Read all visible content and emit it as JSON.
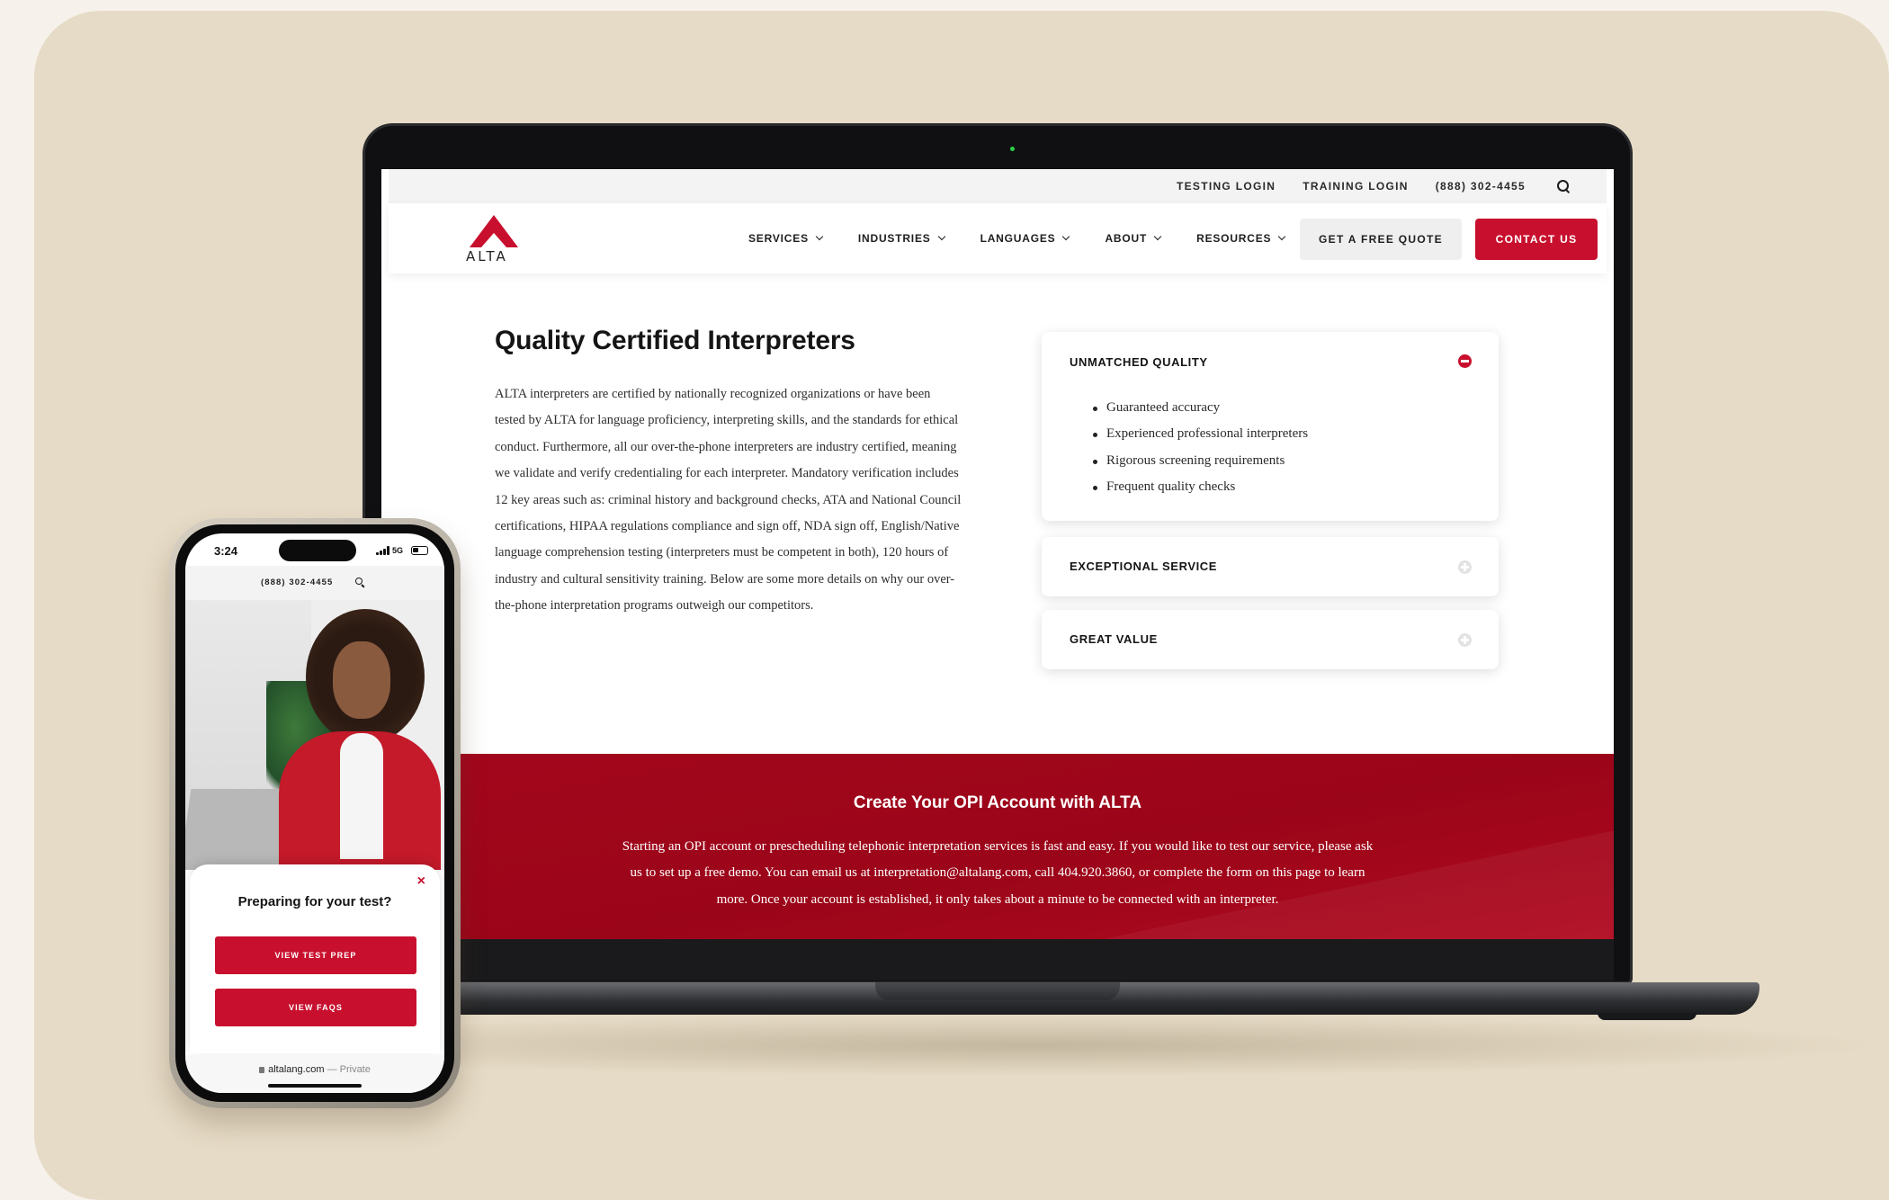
{
  "desktop": {
    "utility_bar": {
      "testing_login": "TESTING LOGIN",
      "training_login": "TRAINING LOGIN",
      "phone": "(888) 302-4455"
    },
    "logo_text": "ALTA",
    "nav": {
      "items": [
        {
          "label": "SERVICES"
        },
        {
          "label": "INDUSTRIES"
        },
        {
          "label": "LANGUAGES"
        },
        {
          "label": "ABOUT"
        },
        {
          "label": "RESOURCES"
        }
      ],
      "quote_button": "GET A FREE QUOTE",
      "contact_button": "CONTACT US"
    },
    "content": {
      "title": "Quality Certified Interpreters",
      "body": "ALTA interpreters are certified by nationally recognized organizations or have been tested by ALTA for language proficiency, interpreting skills, and the standards for ethical conduct. Furthermore, all our over-the-phone interpreters are industry certified, meaning we validate and verify credentialing for each interpreter. Mandatory verification includes 12 key areas such as: criminal history and background checks, ATA and National Council certifications, HIPAA regulations compliance and sign off, NDA sign off, English/Native language comprehension testing (interpreters must be competent in both), 120 hours of industry and cultural sensitivity training. Below are some more details on why our over-the-phone interpretation programs outweigh our competitors."
    },
    "accordion": [
      {
        "title": "UNMATCHED QUALITY",
        "expanded": true,
        "items": [
          "Guaranteed accuracy",
          "Experienced professional interpreters",
          "Rigorous screening requirements",
          "Frequent quality checks"
        ]
      },
      {
        "title": "EXCEPTIONAL SERVICE",
        "expanded": false
      },
      {
        "title": "GREAT VALUE",
        "expanded": false
      }
    ],
    "opi_band": {
      "title": "Create Your OPI Account with ALTA",
      "text": "Starting an OPI account or prescheduling telephonic interpretation services is fast and easy. If you would like to test our service, please ask us to set up a free demo. You can email us at interpretation@altalang.com, call 404.920.3860, or complete the form on this page to learn more. Once your account is established, it only takes about a minute to be connected with an interpreter."
    }
  },
  "mobile": {
    "status": {
      "time": "3:24",
      "network": "5G"
    },
    "utility_phone": "(888) 302-4455",
    "popup": {
      "close": "×",
      "title": "Preparing for your test?",
      "button_test_prep": "VIEW TEST PREP",
      "button_faqs": "VIEW FAQS"
    },
    "url_bar": {
      "domain": "altalang.com",
      "mode": "— Private"
    }
  },
  "colors": {
    "brand_red": "#c8102e",
    "band_red": "#a3061c",
    "backdrop": "#e6dbc6"
  }
}
